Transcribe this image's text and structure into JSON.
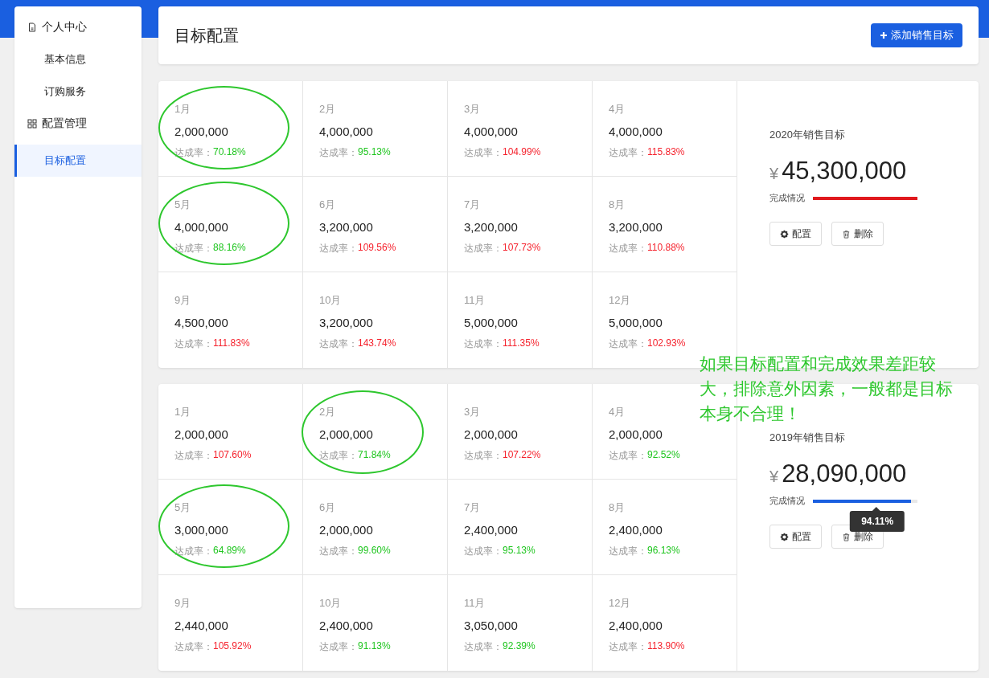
{
  "sidebar": {
    "groups": [
      {
        "label": "个人中心",
        "items": [
          {
            "label": "基本信息",
            "selected": false
          },
          {
            "label": "订购服务",
            "selected": false
          }
        ]
      },
      {
        "label": "配置管理",
        "items": [
          {
            "label": "目标配置",
            "selected": true
          }
        ]
      }
    ]
  },
  "header": {
    "title": "目标配置",
    "add_button": "添加销售目标"
  },
  "targets": [
    {
      "months": [
        {
          "month": "1月",
          "amount": "2,000,000",
          "rate_label": "达成率：",
          "rate": "70.18%",
          "color": "#1fc51f",
          "circled": true
        },
        {
          "month": "2月",
          "amount": "4,000,000",
          "rate_label": "达成率：",
          "rate": "95.13%",
          "color": "#1fc51f",
          "circled": false
        },
        {
          "month": "3月",
          "amount": "4,000,000",
          "rate_label": "达成率：",
          "rate": "104.99%",
          "color": "#f5222d",
          "circled": false
        },
        {
          "month": "4月",
          "amount": "4,000,000",
          "rate_label": "达成率：",
          "rate": "115.83%",
          "color": "#f5222d",
          "circled": false
        },
        {
          "month": "5月",
          "amount": "4,000,000",
          "rate_label": "达成率：",
          "rate": "88.16%",
          "color": "#1fc51f",
          "circled": true
        },
        {
          "month": "6月",
          "amount": "3,200,000",
          "rate_label": "达成率：",
          "rate": "109.56%",
          "color": "#f5222d",
          "circled": false
        },
        {
          "month": "7月",
          "amount": "3,200,000",
          "rate_label": "达成率：",
          "rate": "107.73%",
          "color": "#f5222d",
          "circled": false
        },
        {
          "month": "8月",
          "amount": "3,200,000",
          "rate_label": "达成率：",
          "rate": "110.88%",
          "color": "#f5222d",
          "circled": false
        },
        {
          "month": "9月",
          "amount": "4,500,000",
          "rate_label": "达成率：",
          "rate": "111.83%",
          "color": "#f5222d",
          "circled": false
        },
        {
          "month": "10月",
          "amount": "3,200,000",
          "rate_label": "达成率：",
          "rate": "143.74%",
          "color": "#f5222d",
          "circled": false
        },
        {
          "month": "11月",
          "amount": "5,000,000",
          "rate_label": "达成率：",
          "rate": "111.35%",
          "color": "#f5222d",
          "circled": false
        },
        {
          "month": "12月",
          "amount": "5,000,000",
          "rate_label": "达成率：",
          "rate": "102.93%",
          "color": "#f5222d",
          "circled": false
        }
      ],
      "title": "2020年销售目标",
      "currency": "¥",
      "total": "45,300,000",
      "progress_label": "完成情况",
      "level": 1,
      "color": "#e0191d",
      "config_button": "配置",
      "delete_button": "删除"
    },
    {
      "months": [
        {
          "month": "1月",
          "amount": "2,000,000",
          "rate_label": "达成率：",
          "rate": "107.60%",
          "color": "#f5222d",
          "circled": false
        },
        {
          "month": "2月",
          "amount": "2,000,000",
          "rate_label": "达成率：",
          "rate": "71.84%",
          "color": "#1fc51f",
          "circled": true
        },
        {
          "month": "3月",
          "amount": "2,000,000",
          "rate_label": "达成率：",
          "rate": "107.22%",
          "color": "#f5222d",
          "circled": false
        },
        {
          "month": "4月",
          "amount": "2,000,000",
          "rate_label": "达成率：",
          "rate": "92.52%",
          "color": "#1fc51f",
          "circled": false
        },
        {
          "month": "5月",
          "amount": "3,000,000",
          "rate_label": "达成率：",
          "rate": "64.89%",
          "color": "#1fc51f",
          "circled": true
        },
        {
          "month": "6月",
          "amount": "2,000,000",
          "rate_label": "达成率：",
          "rate": "99.60%",
          "color": "#1fc51f",
          "circled": false
        },
        {
          "month": "7月",
          "amount": "2,400,000",
          "rate_label": "达成率：",
          "rate": "95.13%",
          "color": "#1fc51f",
          "circled": false
        },
        {
          "month": "8月",
          "amount": "2,400,000",
          "rate_label": "达成率：",
          "rate": "96.13%",
          "color": "#1fc51f",
          "circled": false
        },
        {
          "month": "9月",
          "amount": "2,440,000",
          "rate_label": "达成率：",
          "rate": "105.92%",
          "color": "#f5222d",
          "circled": false
        },
        {
          "month": "10月",
          "amount": "2,400,000",
          "rate_label": "达成率：",
          "rate": "91.13%",
          "color": "#1fc51f",
          "circled": false
        },
        {
          "month": "11月",
          "amount": "3,050,000",
          "rate_label": "达成率：",
          "rate": "92.39%",
          "color": "#1fc51f",
          "circled": false
        },
        {
          "month": "12月",
          "amount": "2,400,000",
          "rate_label": "达成率：",
          "rate": "113.90%",
          "color": "#f5222d",
          "circled": false
        }
      ],
      "title": "2019年销售目标",
      "currency": "¥",
      "total": "28,090,000",
      "progress_label": "完成情况",
      "level": 0.9411,
      "color": "#1a5fe0",
      "config_button": "配置",
      "delete_button": "删除",
      "tooltip": "94.11%"
    }
  ],
  "annotation": "如果目标配置和完成效果差距较大，排除意外因素，一般都是目标本身不合理！"
}
